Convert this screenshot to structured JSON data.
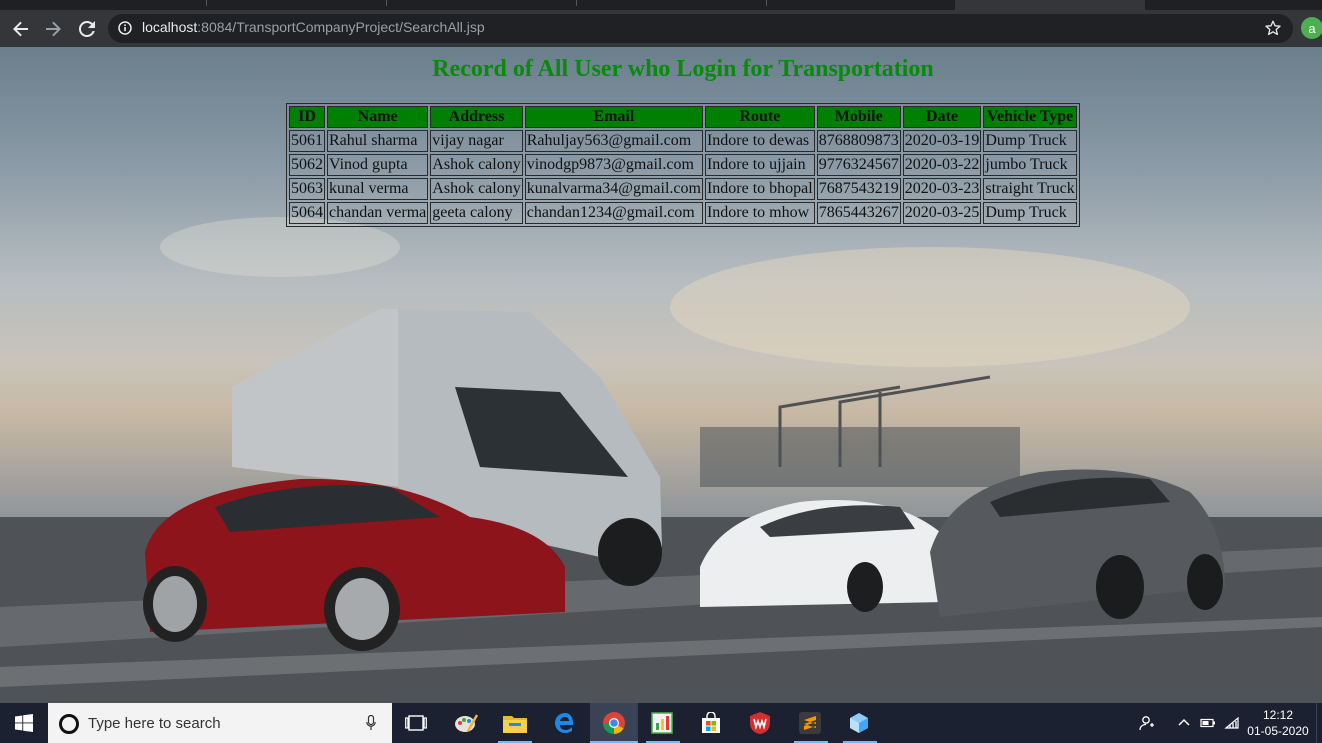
{
  "browser": {
    "url_host": "localhost",
    "url_path": ":8084/TransportCompanyProject/SearchAll.jsp",
    "profile_initial": "a"
  },
  "page": {
    "heading": "Record of All User who Login for Transportation",
    "columns": [
      "ID",
      "Name",
      "Address",
      "Email",
      "Route",
      "Mobile",
      "Date",
      "Vehicle Type"
    ],
    "rows": [
      [
        "5061",
        "Rahul sharma",
        "vijay nagar",
        "Rahuljay563@gmail.com",
        "Indore to dewas",
        "8768809873",
        "2020-03-19",
        "Dump Truck"
      ],
      [
        "5062",
        "Vinod gupta",
        "Ashok calony",
        "vinodgp9873@gmail.com",
        "Indore to ujjain",
        "9776324567",
        "2020-03-22",
        "jumbo Truck"
      ],
      [
        "5063",
        "kunal verma",
        "Ashok calony",
        "kunalvarma34@gmail.com",
        "Indore to bhopal",
        "7687543219",
        "2020-03-23",
        "straight Truck"
      ],
      [
        "5064",
        "chandan verma",
        "geeta calony",
        "chandan1234@gmail.com",
        "Indore to mhow",
        "7865443267",
        "2020-03-25",
        "Dump Truck"
      ]
    ],
    "header_color": "#008000",
    "heading_color": "#0a8a0a"
  },
  "taskbar": {
    "search_placeholder": "Type here to search",
    "time": "12:12",
    "date": "01-05-2020",
    "apps": [
      "task-view",
      "paint",
      "file-explorer",
      "edge",
      "chrome",
      "office-chart",
      "store",
      "antivirus",
      "sublime-text",
      "3d-box"
    ]
  }
}
